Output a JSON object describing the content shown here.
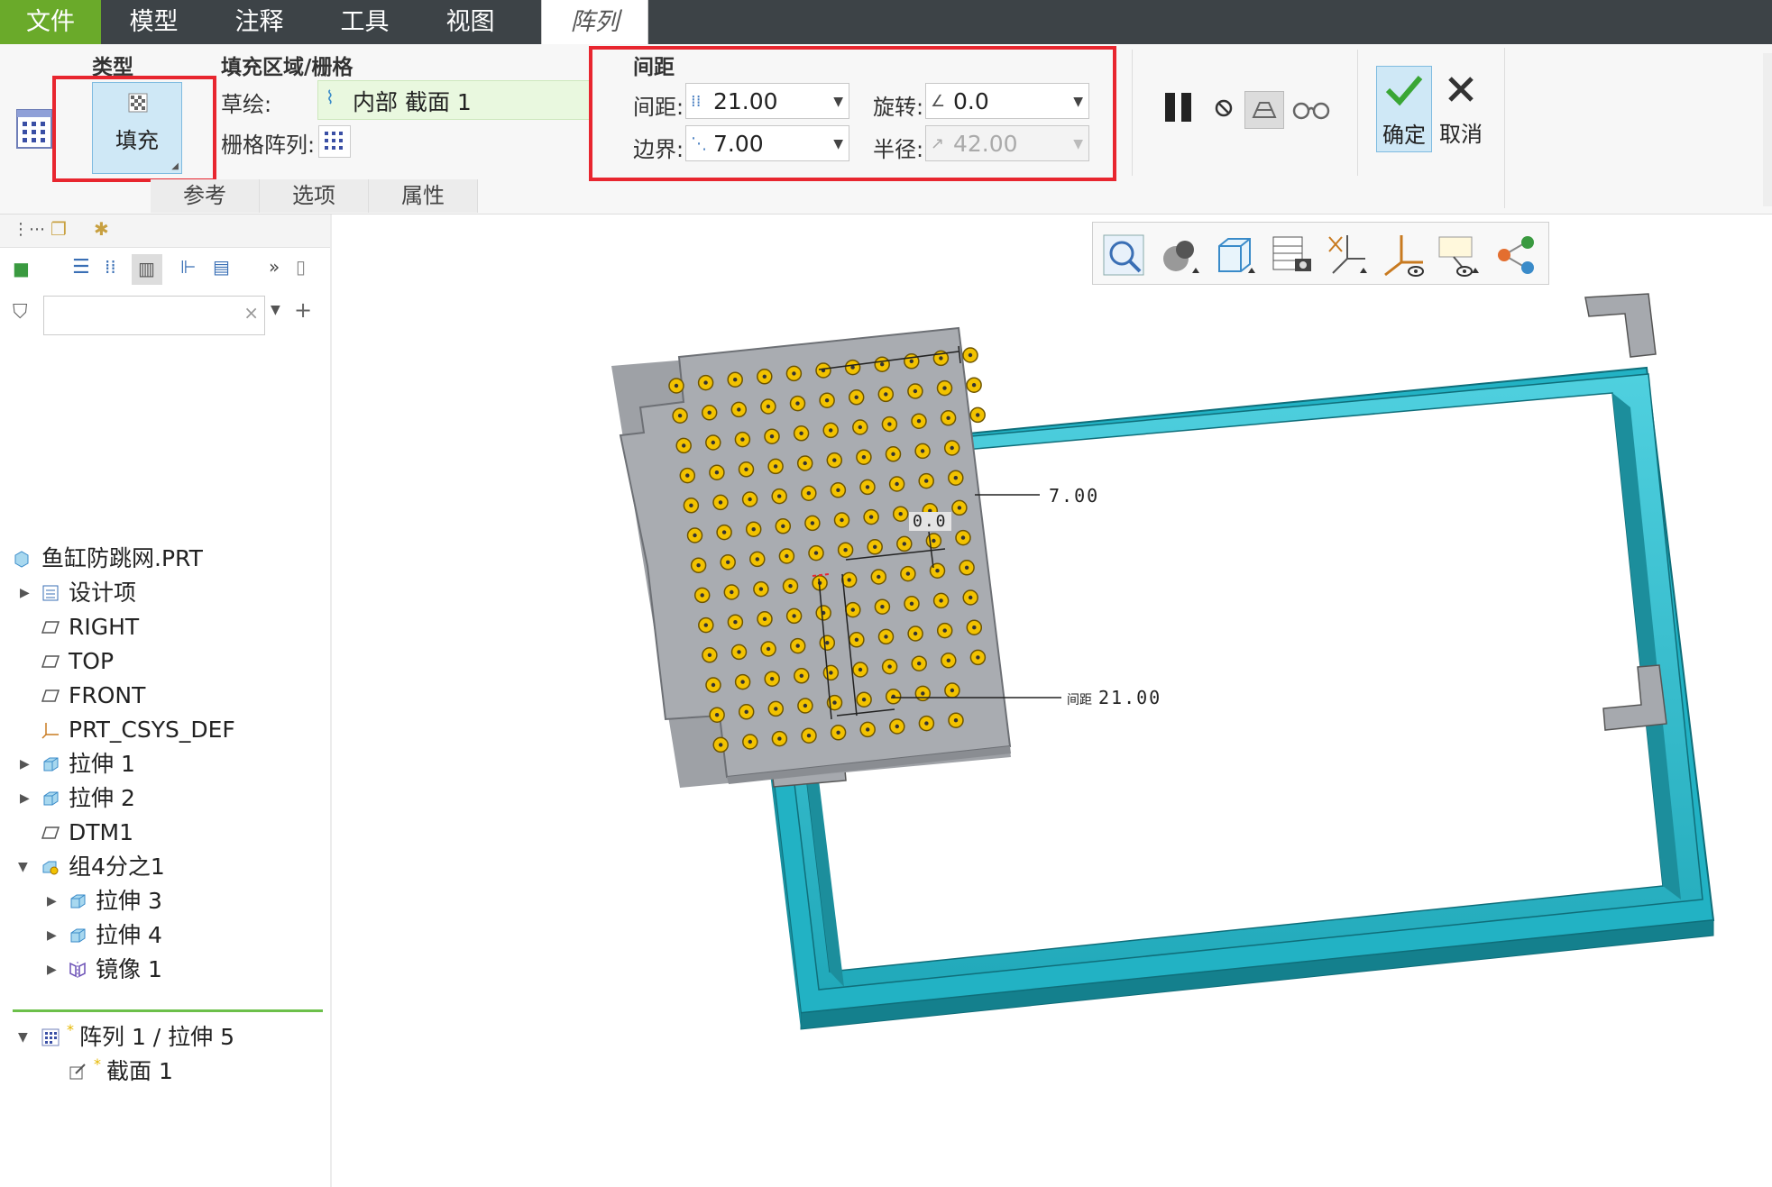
{
  "menubar": {
    "items": [
      "文件",
      "模型",
      "注释",
      "工具",
      "视图",
      "阵列"
    ]
  },
  "ribbon": {
    "type_group": {
      "title": "类型",
      "fill_button": "填充"
    },
    "fill_group": {
      "title": "填充区域/栅格",
      "sketch_label": "草绘:",
      "sketch_value": "内部 截面 1",
      "grid_label": "栅格阵列:"
    },
    "spacing_group": {
      "title": "间距",
      "spacing_label": "间距:",
      "spacing_value": "21.00",
      "rotation_label": "旋转:",
      "rotation_value": "0.0",
      "border_label": "边界:",
      "border_value": "7.00",
      "radius_label": "半径:",
      "radius_value": "42.00"
    },
    "actions": {
      "ok": "确定",
      "cancel": "取消"
    },
    "tabs": [
      "参考",
      "选项",
      "属性"
    ]
  },
  "tree": {
    "items": [
      {
        "label": "鱼缸防跳网.PRT",
        "icon": "part-icon"
      },
      {
        "label": "设计项",
        "icon": "design-items-icon"
      },
      {
        "label": "RIGHT",
        "icon": "datum-plane-icon"
      },
      {
        "label": "TOP",
        "icon": "datum-plane-icon"
      },
      {
        "label": "FRONT",
        "icon": "datum-plane-icon"
      },
      {
        "label": "PRT_CSYS_DEF",
        "icon": "csys-icon"
      },
      {
        "label": "拉伸 1",
        "icon": "extrude-icon"
      },
      {
        "label": "拉伸 2",
        "icon": "extrude-icon"
      },
      {
        "label": "DTM1",
        "icon": "datum-plane-icon"
      },
      {
        "label": "组4分之1",
        "icon": "group-icon"
      },
      {
        "label": "拉伸 3",
        "icon": "extrude-icon"
      },
      {
        "label": "拉伸 4",
        "icon": "extrude-icon"
      },
      {
        "label": "镜像 1",
        "icon": "mirror-icon"
      },
      {
        "label": "阵列 1 / 拉伸 5",
        "icon": "pattern-icon"
      },
      {
        "label": "截面 1",
        "icon": "sketch-icon"
      }
    ]
  },
  "viewport": {
    "dim_border": "7.00",
    "dim_spacing_prefix": "间距",
    "dim_spacing": "21.00",
    "dim_rotation": "0.0"
  },
  "colors": {
    "menubar_bg": "#3d4347",
    "file_tab": "#6aaa2a",
    "highlight_red": "#e8262f",
    "frame_cyan": "#2cbacb",
    "plate_gray": "#a9acb1",
    "hole_yellow": "#f2c200"
  }
}
